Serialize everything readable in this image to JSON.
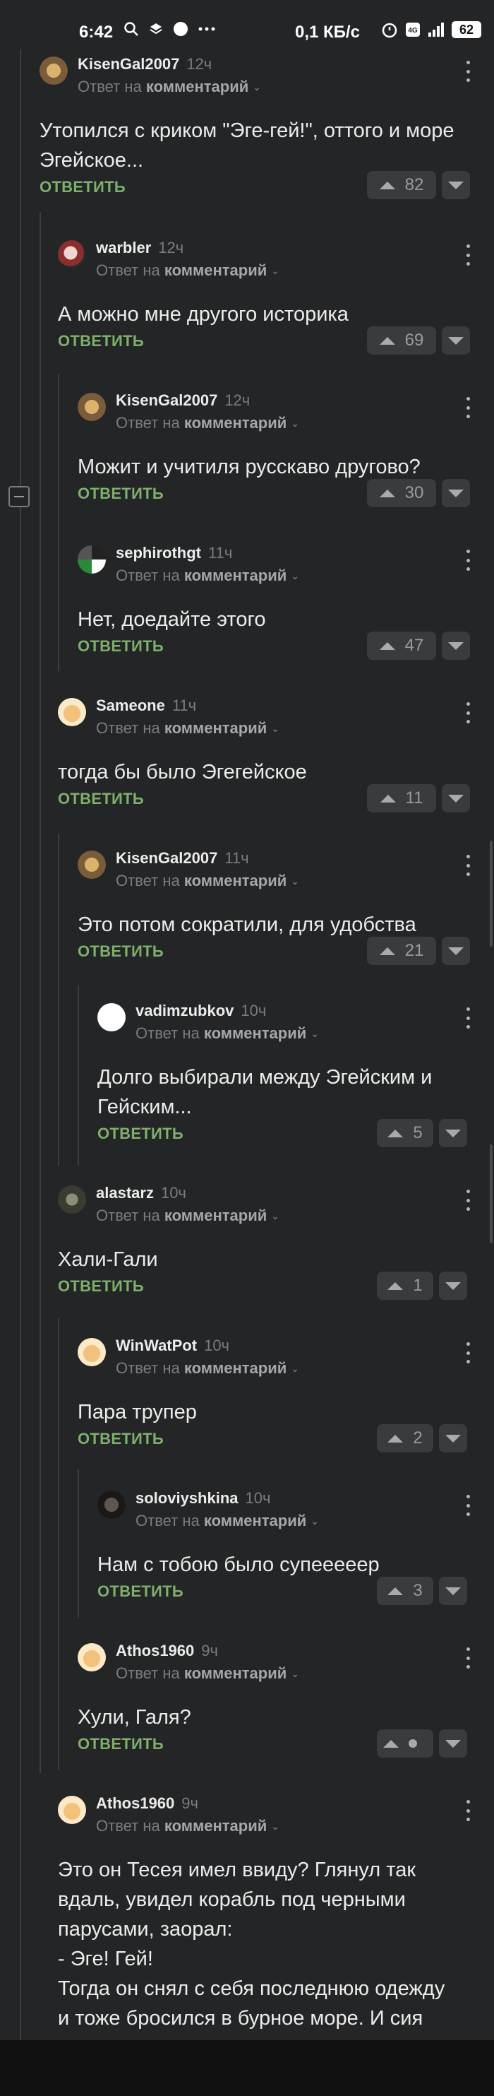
{
  "status_bar": {
    "time": "6:42",
    "network_speed": "0,1 КБ/с",
    "battery": "62",
    "icons_left": [
      "search-icon",
      "layers-icon",
      "circle-icon",
      "more-icon"
    ],
    "icons_right": [
      "alarm-icon",
      "hd-icon",
      "signal-icon"
    ]
  },
  "labels": {
    "reply_to_prefix": "Ответ на",
    "reply_to_target": "комментарий",
    "reply_action": "ОТВЕТИТЬ"
  },
  "comments": [
    {
      "username": "KisenGal2007",
      "time": "12ч",
      "text": "Утопился с криком \"Эге-гей!\", оттого и море Эгейское...",
      "votes": "82"
    },
    {
      "username": "warbler",
      "time": "12ч",
      "text": "А можно мне другого историка",
      "votes": "69"
    },
    {
      "username": "KisenGal2007",
      "time": "12ч",
      "text": "Можит и учитиля русскаво другово?",
      "votes": "30"
    },
    {
      "username": "sephirothgt",
      "time": "11ч",
      "text": "Нет, доедайте этого",
      "votes": "47"
    },
    {
      "username": "Sameone",
      "time": "11ч",
      "text": "тогда бы было Эгегейское",
      "votes": "11"
    },
    {
      "username": "KisenGal2007",
      "time": "11ч",
      "text": "Это потом сократили, для удобства",
      "votes": "21"
    },
    {
      "username": "vadimzubkov",
      "time": "10ч",
      "text": "Долго выбирали между Эгейским и Гейским...",
      "votes": "5"
    },
    {
      "username": "alastarz",
      "time": "10ч",
      "text": "Хали-Гали",
      "votes": "1"
    },
    {
      "username": "WinWatPot",
      "time": "10ч",
      "text": "Пара трупер",
      "votes": "2"
    },
    {
      "username": "soloviyshkina",
      "time": "10ч",
      "text": "Нам с тобою было супееееер",
      "votes": "3"
    },
    {
      "username": "Athos1960",
      "time": "9ч",
      "text": "Хули, Галя?",
      "votes": ""
    },
    {
      "username": "Athos1960",
      "time": "9ч",
      "text": "Это он Тесея имел ввиду? Глянул так вдаль, увидел корабль под черными парусами, заорал:\n- Эге! Гей!\nТогда он снял с себя последнюю одежду и тоже бросился в бурное море. И сия",
      "votes": ""
    }
  ]
}
